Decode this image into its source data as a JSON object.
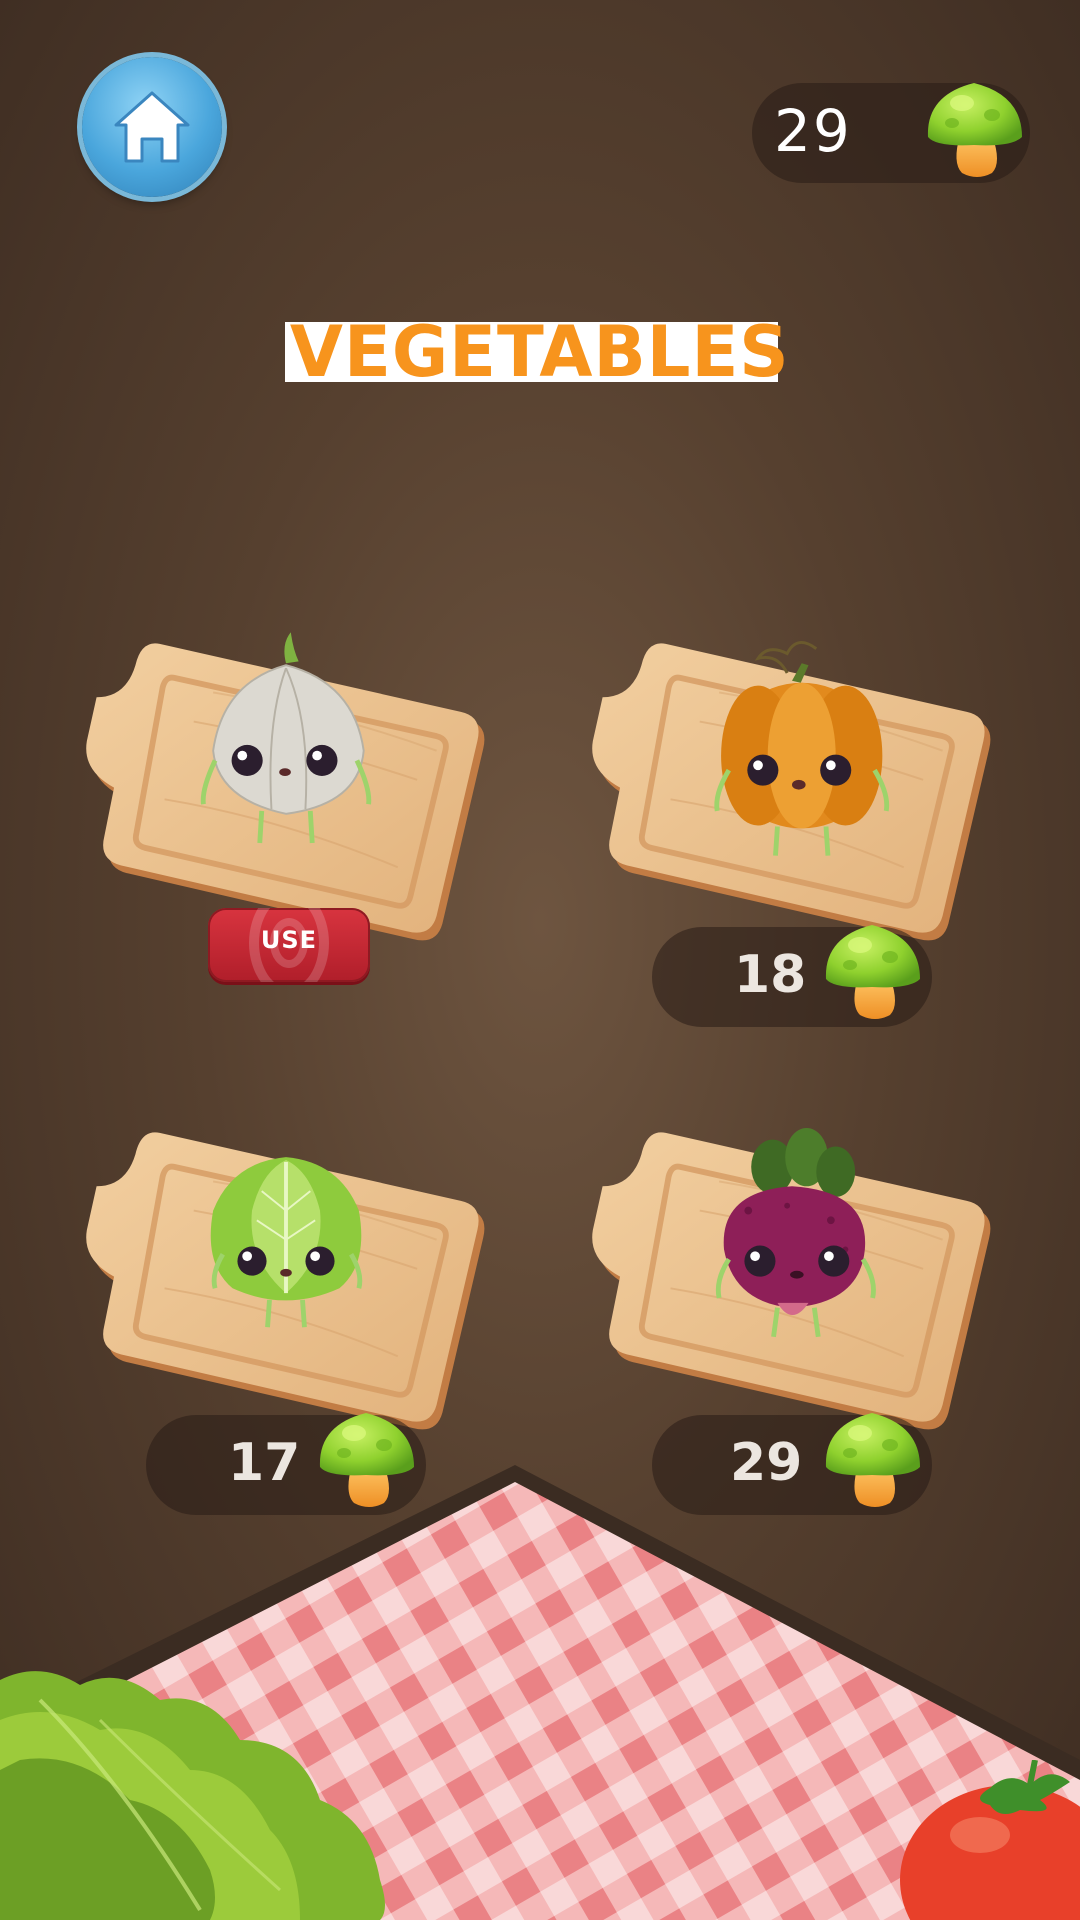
{
  "header": {
    "coins": "29",
    "title": "VEGETABLES"
  },
  "items": [
    {
      "name": "garlic",
      "action_label": "USE"
    },
    {
      "name": "pumpkin",
      "price": "18"
    },
    {
      "name": "lettuce",
      "price": "17"
    },
    {
      "name": "beet",
      "price": "29"
    }
  ],
  "icons": {
    "home": "home-icon",
    "currency": "mushroom-icon"
  },
  "colors": {
    "title": "#f7941d",
    "use_button": "#c8282f",
    "home_button": "#4aa6dc",
    "mushroom_cap": "#8fd12e",
    "mushroom_stem": "#f5a53a"
  }
}
